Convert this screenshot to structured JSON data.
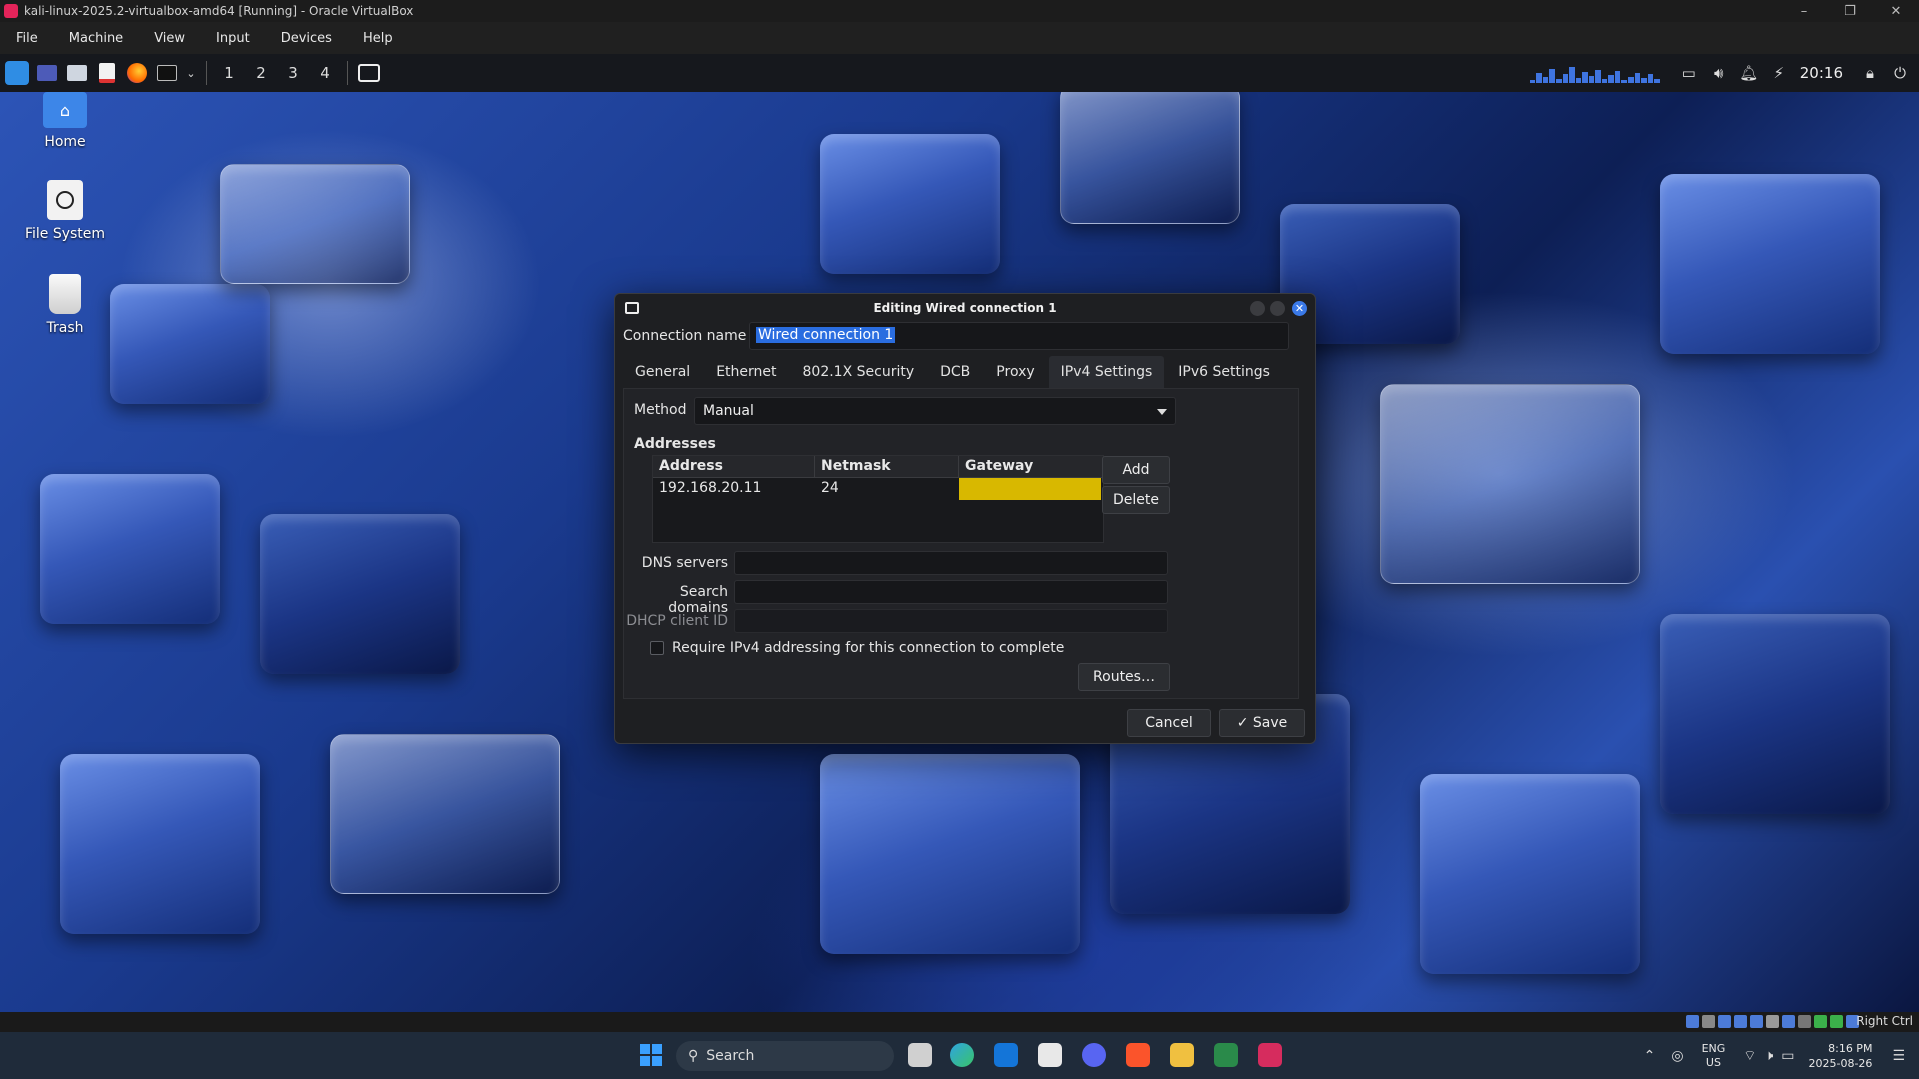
{
  "host_window": {
    "title": "kali-linux-2025.2-virtualbox-amd64 [Running] - Oracle VirtualBox",
    "menu": [
      "File",
      "Machine",
      "View",
      "Input",
      "Devices",
      "Help"
    ],
    "host_key_label": "Right Ctrl"
  },
  "kali_panel": {
    "workspaces": [
      "1",
      "2",
      "3",
      "4"
    ],
    "clock": "20:16"
  },
  "desktop_icons": [
    {
      "label": "Home",
      "icon": "home-folder-icon"
    },
    {
      "label": "File System",
      "icon": "drive-icon"
    },
    {
      "label": "Trash",
      "icon": "trash-icon"
    }
  ],
  "dialog": {
    "title": "Editing Wired connection 1",
    "connection_name_label": "Connection name",
    "connection_name_value": "Wired connection 1",
    "tabs": [
      "General",
      "Ethernet",
      "802.1X Security",
      "DCB",
      "Proxy",
      "IPv4 Settings",
      "IPv6 Settings"
    ],
    "active_tab": "IPv4 Settings",
    "method_label": "Method",
    "method_value": "Manual",
    "addresses_heading": "Addresses",
    "columns": [
      "Address",
      "Netmask",
      "Gateway"
    ],
    "rows": [
      {
        "address": "192.168.20.11",
        "netmask": "24",
        "gateway": ""
      }
    ],
    "add_label": "Add",
    "delete_label": "Delete",
    "dns_label": "DNS servers",
    "search_domains_label": "Search domains",
    "dhcp_client_id_label": "DHCP client ID",
    "require_ipv4_label": "Require IPv4 addressing for this connection to complete",
    "routes_label": "Routes…",
    "cancel_label": "Cancel",
    "save_label": "Save",
    "gateway_highlight_color": "#d8b800",
    "selection_color": "#2a6de0"
  },
  "win_taskbar": {
    "search_label": "Search",
    "lang_top": "ENG",
    "lang_bottom": "US",
    "time": "8:16 PM",
    "date": "2025-08-26"
  }
}
